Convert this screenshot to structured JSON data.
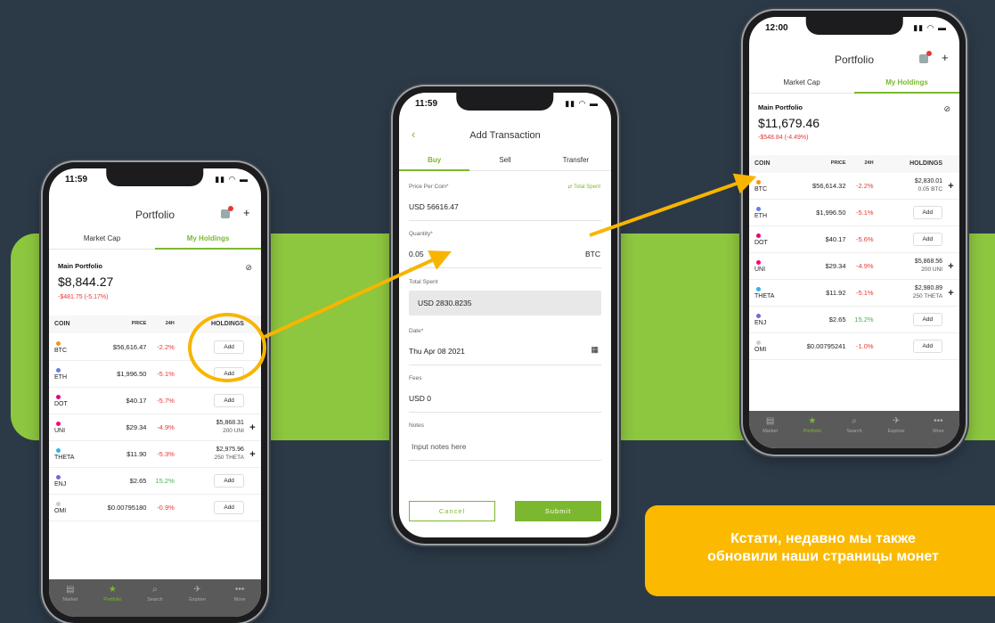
{
  "colors": {
    "background": "#2c3a48",
    "band": "#8dc63f",
    "accent": "#7cb82f",
    "banner": "#fbb900",
    "arrow": "#f7b500",
    "negative": "#e53935"
  },
  "banner": {
    "line1": "Кстати, недавно мы также",
    "line2": "обновили наши страницы монет"
  },
  "phone_left": {
    "time": "11:59",
    "title": "Portfolio",
    "tabs": [
      "Market Cap",
      "My Holdings"
    ],
    "portfolio_label": "Main Portfolio",
    "portfolio_value": "$8,844.27",
    "portfolio_change": "-$481.75 (-5.17%)",
    "columns": [
      "COIN",
      "PRICE",
      "24H",
      "HOLDINGS"
    ],
    "rows": [
      {
        "coin": "BTC",
        "price": "$56,616.47",
        "change": "-2.2%",
        "holdings": "",
        "holdings_sub": "",
        "action": "Add"
      },
      {
        "coin": "ETH",
        "price": "$1,996.50",
        "change": "-5.1%",
        "holdings": "",
        "holdings_sub": "",
        "action": "Add"
      },
      {
        "coin": "DOT",
        "price": "$40.17",
        "change": "-5.7%",
        "holdings": "",
        "holdings_sub": "",
        "action": "Add"
      },
      {
        "coin": "UNI",
        "price": "$29.34",
        "change": "-4.9%",
        "holdings": "$5,868.31",
        "holdings_sub": "200 UNI",
        "action": "+"
      },
      {
        "coin": "THETA",
        "price": "$11.90",
        "change": "-5.3%",
        "holdings": "$2,975.96",
        "holdings_sub": "250 THETA",
        "action": "+"
      },
      {
        "coin": "ENJ",
        "price": "$2.65",
        "change": "15.2%",
        "holdings": "",
        "holdings_sub": "",
        "action": "Add"
      },
      {
        "coin": "OMI",
        "price": "$0.00795180",
        "change": "-0.9%",
        "holdings": "",
        "holdings_sub": "",
        "action": "Add"
      }
    ],
    "nav": [
      "Market",
      "Portfolio",
      "Search",
      "Explore",
      "More"
    ]
  },
  "phone_middle": {
    "time": "11:59",
    "title": "Add Transaction",
    "tabs": [
      "Buy",
      "Sell",
      "Transfer"
    ],
    "price_label": "Price Per Coin",
    "total_spent_link": "Total Spent",
    "price_value": "USD 56616.47",
    "quantity_label": "Quantity",
    "quantity_value": "0.05",
    "quantity_unit": "BTC",
    "total_label": "Total Spent",
    "total_value": "USD 2830.8235",
    "date_label": "Date",
    "date_value": "Thu Apr 08 2021",
    "fees_label": "Fees",
    "fees_value": "USD 0",
    "notes_label": "Notes",
    "notes_placeholder": "Input notes here",
    "cancel": "Cancel",
    "submit": "Submit"
  },
  "phone_right": {
    "time": "12:00",
    "title": "Portfolio",
    "tabs": [
      "Market Cap",
      "My Holdings"
    ],
    "portfolio_label": "Main Portfolio",
    "portfolio_value": "$11,679.46",
    "portfolio_change": "-$548.84 (-4.49%)",
    "columns": [
      "COIN",
      "PRICE",
      "24H",
      "HOLDINGS"
    ],
    "rows": [
      {
        "coin": "BTC",
        "price": "$56,614.32",
        "change": "-2.2%",
        "holdings": "$2,830.01",
        "holdings_sub": "0.05 BTC",
        "action": "+"
      },
      {
        "coin": "ETH",
        "price": "$1,996.50",
        "change": "-5.1%",
        "holdings": "",
        "holdings_sub": "",
        "action": "Add"
      },
      {
        "coin": "DOT",
        "price": "$40.17",
        "change": "-5.6%",
        "holdings": "",
        "holdings_sub": "",
        "action": "Add"
      },
      {
        "coin": "UNI",
        "price": "$29.34",
        "change": "-4.9%",
        "holdings": "$5,868.56",
        "holdings_sub": "200 UNI",
        "action": "+"
      },
      {
        "coin": "THETA",
        "price": "$11.92",
        "change": "-5.1%",
        "holdings": "$2,980.89",
        "holdings_sub": "250 THETA",
        "action": "+"
      },
      {
        "coin": "ENJ",
        "price": "$2.65",
        "change": "15.2%",
        "holdings": "",
        "holdings_sub": "",
        "action": "Add"
      },
      {
        "coin": "OMI",
        "price": "$0.00795241",
        "change": "-1.0%",
        "holdings": "",
        "holdings_sub": "",
        "action": "Add"
      }
    ],
    "nav": [
      "Market",
      "Portfolio",
      "Search",
      "Explore",
      "More"
    ]
  }
}
